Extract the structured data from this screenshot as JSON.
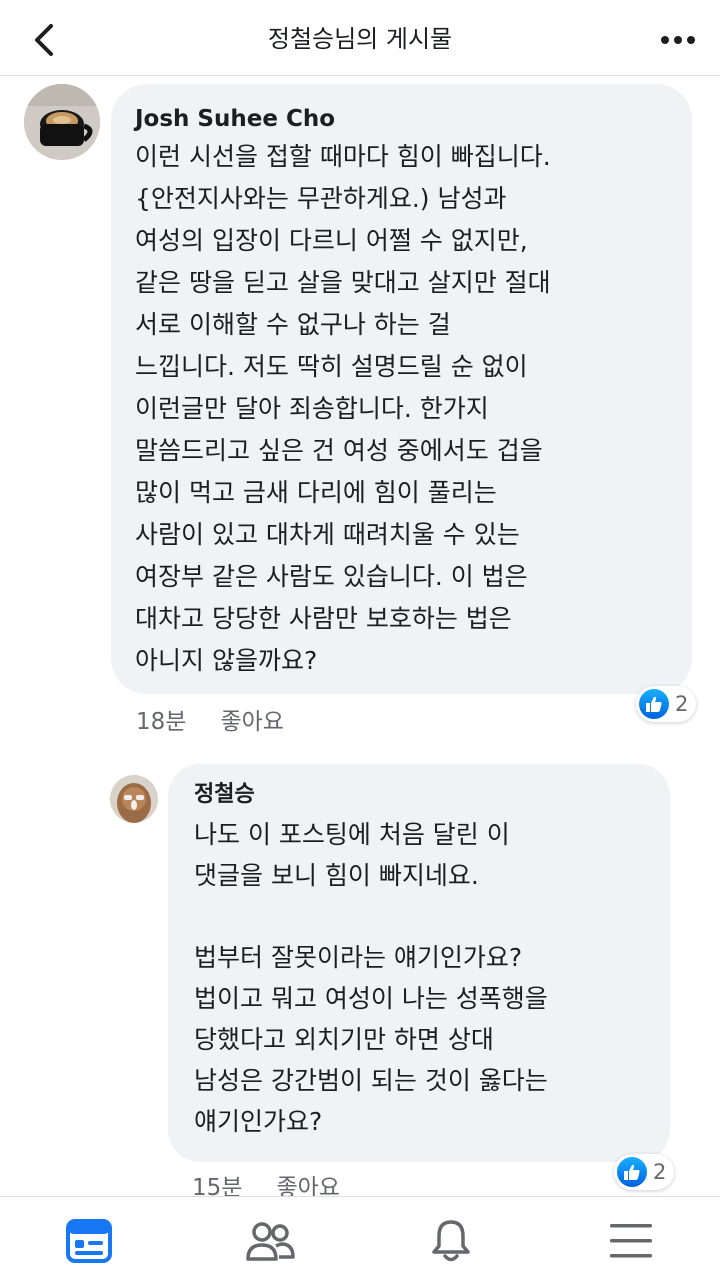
{
  "header": {
    "title": "정철승님의 게시물"
  },
  "comments": [
    {
      "author": "Josh Suhee Cho",
      "text": "이런 시선을 접할 때마다 힘이 빠집니다.\n{안전지사와는 무관하게요.) 남성과\n여성의 입장이 다르니 어쩔 수 없지만,\n같은 땅을 딛고 살을 맞대고 살지만 절대\n서로 이해할 수 없구나 하는 걸\n느낍니다. 저도 딱히 설명드릴 순 없이\n이런글만 달아 죄송합니다. 한가지\n말씀드리고 싶은 건 여성 중에서도 겁을\n많이 먹고 금새 다리에 힘이 풀리는\n사람이 있고 대차게 때려치울 수 있는\n여장부 같은 사람도 있습니다. 이 법은\n대차고 당당한 사람만 보호하는 법은\n아니지 않을까요?",
      "time": "18분",
      "like_label": "좋아요",
      "reaction_count": "2"
    },
    {
      "author": "정철승",
      "text": "나도 이 포스팅에 처음 달린 이\n댓글을 보니 힘이 빠지네요.\n\n법부터 잘못이라는 얘기인가요?\n법이고 뭐고 여성이 나는 성폭행을\n당했다고 외치기만 하면 상대\n남성은 강간범이 되는 것이 옳다는\n얘기인가요?",
      "time": "15분",
      "like_label": "좋아요",
      "reaction_count": "2"
    }
  ],
  "icons": {
    "back": "chevron-left-icon",
    "more": "more-dots-icon",
    "like_reaction": "thumbs-up-icon",
    "nav": [
      "news-feed-icon",
      "friends-icon",
      "notifications-bell-icon",
      "menu-icon"
    ]
  },
  "colors": {
    "accent": "#1877f2",
    "bubble": "#f0f2f5",
    "secondary_text": "#65676b"
  }
}
